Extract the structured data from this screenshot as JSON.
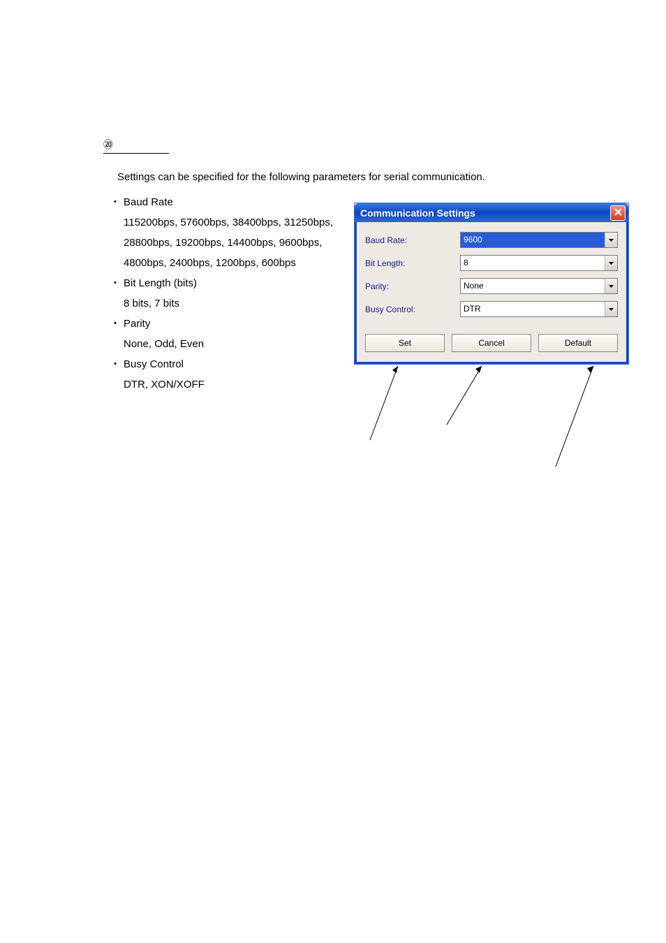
{
  "section_marker": "⑳",
  "intro": "Settings can be specified for the following parameters for serial communication.",
  "bullets": [
    {
      "title": "Baud Rate",
      "body": [
        "115200bps, 57600bps, 38400bps, 31250bps,",
        "28800bps, 19200bps, 14400bps, 9600bps,",
        "4800bps, 2400bps, 1200bps, 600bps"
      ]
    },
    {
      "title": "Bit Length (bits)",
      "body": [
        "8 bits, 7 bits"
      ]
    },
    {
      "title": "Parity",
      "body": [
        "None, Odd, Even"
      ]
    },
    {
      "title": "Busy Control",
      "body": [
        "DTR, XON/XOFF"
      ]
    }
  ],
  "dialog": {
    "title": "Communication Settings",
    "fields": [
      {
        "label": "Baud Rate:",
        "value": "9600",
        "selected": true
      },
      {
        "label": "Bit Length:",
        "value": "8",
        "selected": false
      },
      {
        "label": "Parity:",
        "value": "None",
        "selected": false
      },
      {
        "label": "Busy Control:",
        "value": "DTR",
        "selected": false
      }
    ],
    "buttons": {
      "set": "Set",
      "cancel": "Cancel",
      "default": "Default"
    }
  }
}
